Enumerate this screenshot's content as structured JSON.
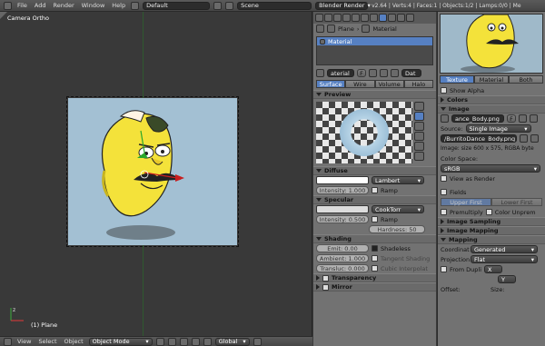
{
  "topbar": {
    "menus": [
      "File",
      "Add",
      "Render",
      "Window",
      "Help"
    ],
    "layout": "Default",
    "scene": "Scene",
    "engine": "Blender Render",
    "stats": "v2.64 | Verts:4 | Faces:1 | Objects:1/2 | Lamps:0/0 | Me"
  },
  "viewport": {
    "camera_label": "Camera Ortho",
    "object_label": "(1) Plane",
    "menus": [
      "View",
      "Select",
      "Object"
    ],
    "mode": "Object Mode",
    "orientation": "Global",
    "bg_color": "#a3c0d3"
  },
  "properties": {
    "breadcrumb": [
      "Plane",
      "Material"
    ],
    "material_slot": "Material",
    "material_name": "aterial",
    "users": "F",
    "data": "Dat",
    "tabs": [
      "Surface",
      "Wire",
      "Volume",
      "Halo"
    ],
    "preview_title": "Preview",
    "diffuse_title": "Diffuse",
    "diffuse_shader": "Lambert",
    "diffuse_intensity": "Intensity: 1.000",
    "ramp": "Ramp",
    "specular_title": "Specular",
    "specular_shader": "CookTorr",
    "specular_intensity": "Intensity: 0.500",
    "hardness": "Hardness: 50",
    "shading_title": "Shading",
    "emit": "Emit: 0.00",
    "ambient": "Ambient: 1.000",
    "translucency": "Transluc: 0.000",
    "shadeless": "Shadeless",
    "tangent": "Tangent Shading",
    "cubic": "Cubic Interpolat",
    "transparency_title": "Transparency",
    "mirror_title": "Mirror"
  },
  "texture": {
    "tabs": [
      "Texture",
      "Material",
      "Both"
    ],
    "show_alpha": "Show Alpha",
    "colors": "Colors",
    "image_title": "Image",
    "image_name": "ance_Body.png",
    "image_users": "F",
    "source_label": "Source:",
    "source_value": "Single Image",
    "filepath": "/BurritoDance_Body.png",
    "image_info": "Image: size 600 x 575, RGBA byte",
    "color_space_label": "Color Space:",
    "color_space": "sRGB",
    "view_as_render": "View as Render",
    "fields": "Fields",
    "upper_first": "Upper First",
    "lower_first": "Lower First",
    "premultiply": "Premultiply",
    "color_unpremul": "Color Unprem",
    "image_sampling": "Image Sampling",
    "image_mapping": "Image Mapping",
    "mapping_title": "Mapping",
    "coordinates_label": "Coordinat",
    "coordinates": "Generated",
    "projection_label": "Projection",
    "projection": "Flat",
    "from_dupli": "From Dupli",
    "x_axis": "X",
    "y_axis": "Y",
    "offset_label": "Offset:",
    "size_label": "Size:"
  }
}
